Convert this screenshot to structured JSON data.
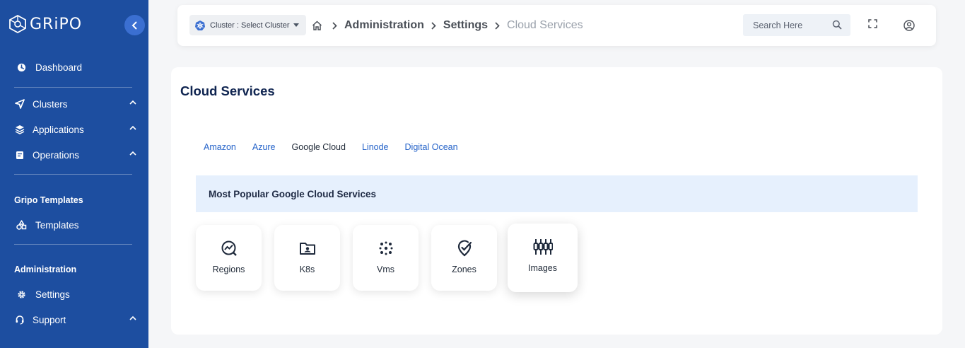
{
  "brand": {
    "logo_text": "GRiPO"
  },
  "sidebar": {
    "dashboard": "Dashboard",
    "clusters": "Clusters",
    "applications": "Applications",
    "operations": "Operations",
    "templates_section": "Gripo Templates",
    "templates": "Templates",
    "admin_section": "Administration",
    "settings": "Settings",
    "support": "Support"
  },
  "topbar": {
    "cluster_select": "Cluster : Select Cluster",
    "breadcrumb": [
      "Administration",
      "Settings",
      "Cloud Services"
    ],
    "search_placeholder": "Search Here"
  },
  "main": {
    "title": "Cloud Services",
    "tabs": [
      "Amazon",
      "Azure",
      "Google Cloud",
      "Linode",
      "Digital Ocean"
    ],
    "active_tab": "Google Cloud",
    "banner": "Most Popular Google Cloud Services",
    "services": [
      {
        "label": "Regions",
        "icon": "regions-icon"
      },
      {
        "label": "K8s",
        "icon": "k8s-icon"
      },
      {
        "label": "Vms",
        "icon": "vms-icon"
      },
      {
        "label": "Zones",
        "icon": "zones-icon"
      },
      {
        "label": "Images",
        "icon": "images-icon"
      }
    ]
  },
  "colors": {
    "sidebar_bg": "#1d4ea0",
    "link_blue": "#2563c9",
    "banner_bg": "#e6f0fd",
    "title_navy": "#0f2450"
  }
}
